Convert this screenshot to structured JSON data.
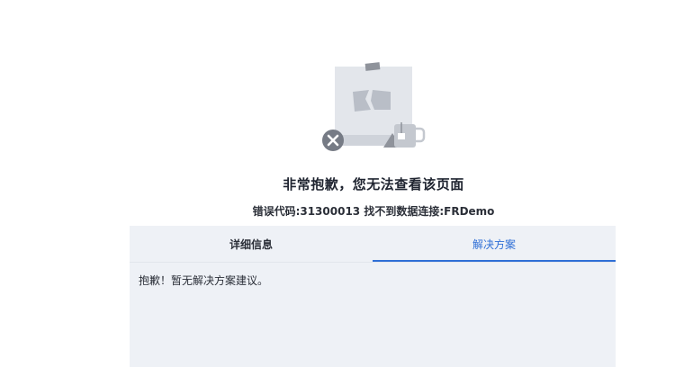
{
  "error": {
    "title": "非常抱歉，您无法查看该页面",
    "detail": "错误代码:31300013 找不到数据连接:FRDemo"
  },
  "tabs": [
    {
      "label": "详细信息",
      "active": false
    },
    {
      "label": "解决方案",
      "active": true
    }
  ],
  "solution_text": "抱歉！暂无解决方案建议。",
  "colors": {
    "accent": "#2f6fd6",
    "panel_bg": "#eef1f6",
    "illustration_gray": "#d9dde4",
    "close_badge": "#767b85"
  },
  "icons": {
    "illustration": "broken-document-illustration",
    "badge": "close-icon",
    "cup": "coffee-cup-icon"
  }
}
